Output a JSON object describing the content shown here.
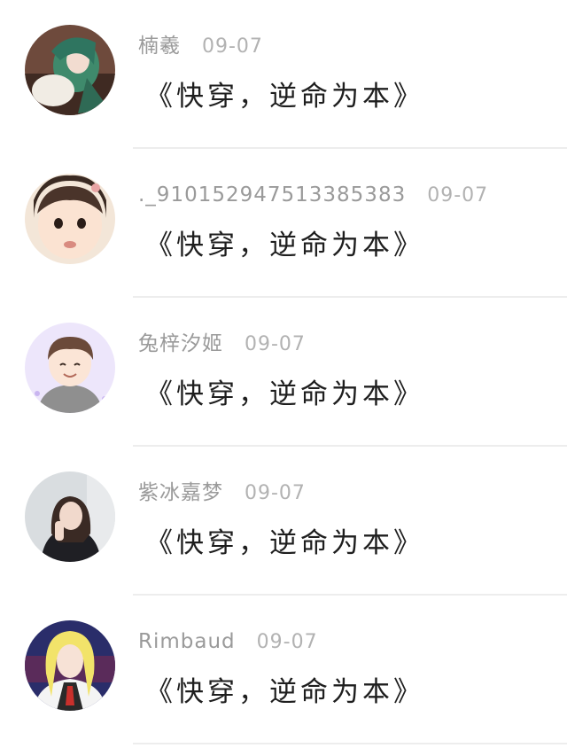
{
  "comments": [
    {
      "avatar": "anime-green-hair-avatar",
      "name": "楠羲",
      "date": "09-07",
      "message": "《快穿，逆命为本》"
    },
    {
      "avatar": "child-photo-avatar",
      "name": "._910152947513385383",
      "date": "09-07",
      "message": "《快穿，逆命为本》"
    },
    {
      "avatar": "cartoon-boy-avatar",
      "name": "兔梓汐姬",
      "date": "09-07",
      "message": "《快穿，逆命为本》"
    },
    {
      "avatar": "girl-photo-avatar",
      "name": "紫冰嘉梦",
      "date": "09-07",
      "message": "《快穿，逆命为本》"
    },
    {
      "avatar": "anime-blond-avatar",
      "name": "Rimbaud",
      "date": "09-07",
      "message": "《快穿，逆命为本》"
    }
  ]
}
